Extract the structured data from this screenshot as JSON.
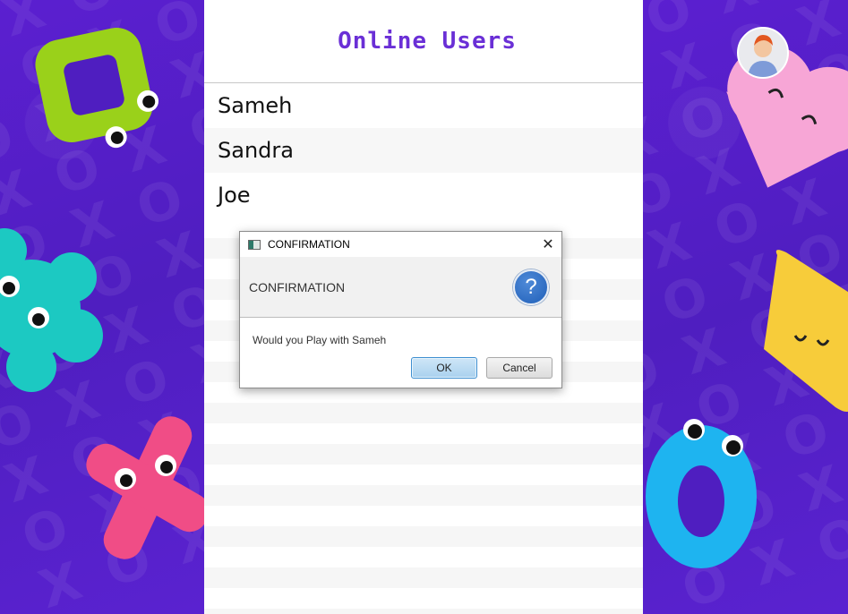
{
  "header": {
    "title": "Online Users"
  },
  "users": [
    "Sameh",
    "Sandra",
    "Joe"
  ],
  "dialog": {
    "window_title": "CONFIRMATION",
    "header_text": "CONFIRMATION",
    "close_symbol": "✕",
    "help_symbol": "?",
    "message": "Would you Play with Sameh",
    "ok_label": "OK",
    "cancel_label": "Cancel"
  },
  "icons": {
    "avatar": "user-avatar-icon",
    "help": "question-icon",
    "close": "close-icon"
  },
  "colors": {
    "background": "#5a22c8",
    "title": "#6a2fd6",
    "ok_button": "#a9d1ee"
  }
}
